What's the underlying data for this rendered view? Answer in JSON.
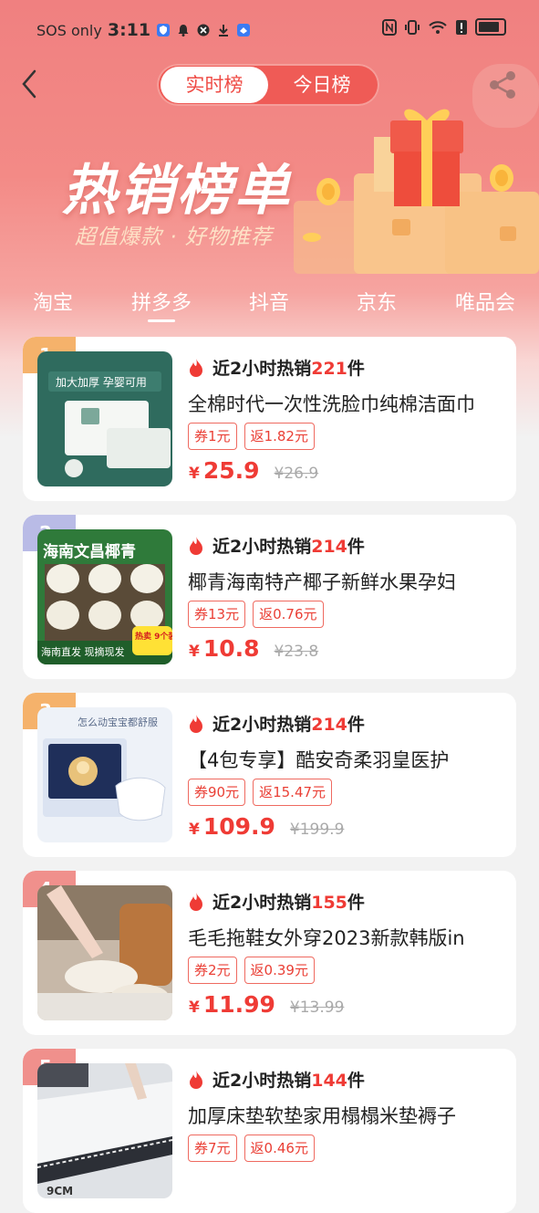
{
  "status": {
    "left_text": "SOS only",
    "time": "3:11",
    "battery_level": 0.9
  },
  "header": {
    "segment": [
      "实时榜",
      "今日榜"
    ],
    "title": "热销榜单",
    "subtitle": "超值爆款 · 好物推荐"
  },
  "tabs": [
    "淘宝",
    "拼多多",
    "抖音",
    "京东",
    "唯品会"
  ],
  "active_tab": "拼多多",
  "colors": {
    "accent": "#ef3b35",
    "rank1": "#f5b26b",
    "rank2": "#b9bbe6",
    "rank3": "#f5b26b",
    "rank4": "#f0908c",
    "rank5": "#f0908c"
  },
  "products": [
    {
      "rank": "1",
      "hot_prefix": "近2小时热销",
      "hot_count": "221",
      "hot_suffix": "件",
      "title": "全棉时代一次性洗脸巾纯棉洁面巾",
      "coupon": "券1元",
      "rebate": "返1.82元",
      "price": "25.9",
      "original": "¥26.9"
    },
    {
      "rank": "2",
      "hot_prefix": "近2小时热销",
      "hot_count": "214",
      "hot_suffix": "件",
      "title": "椰青海南特产椰子新鲜水果孕妇",
      "coupon": "券13元",
      "rebate": "返0.76元",
      "price": "10.8",
      "original": "¥23.8"
    },
    {
      "rank": "3",
      "hot_prefix": "近2小时热销",
      "hot_count": "214",
      "hot_suffix": "件",
      "title": "【4包专享】酷安奇柔羽皇医护",
      "coupon": "券90元",
      "rebate": "返15.47元",
      "price": "109.9",
      "original": "¥199.9"
    },
    {
      "rank": "4",
      "hot_prefix": "近2小时热销",
      "hot_count": "155",
      "hot_suffix": "件",
      "title": "毛毛拖鞋女外穿2023新款韩版in",
      "coupon": "券2元",
      "rebate": "返0.39元",
      "price": "11.99",
      "original": "¥13.99"
    },
    {
      "rank": "5",
      "hot_prefix": "近2小时热销",
      "hot_count": "144",
      "hot_suffix": "件",
      "title": "加厚床垫软垫家用榻榻米垫褥子",
      "coupon": "券7元",
      "rebate": "返0.46元",
      "price": "",
      "original": ""
    }
  ],
  "currency": "¥",
  "thumbs": {
    "p1": {
      "line1": "加大加厚 孕婴可用"
    },
    "p2": {
      "line1": "海南文昌椰青",
      "line2": "海南直发  现摘现发",
      "badge": "热卖 9个装"
    },
    "p3": {
      "line1": "怎么动宝宝都舒服"
    },
    "p5": {
      "line1": "9CM"
    }
  }
}
